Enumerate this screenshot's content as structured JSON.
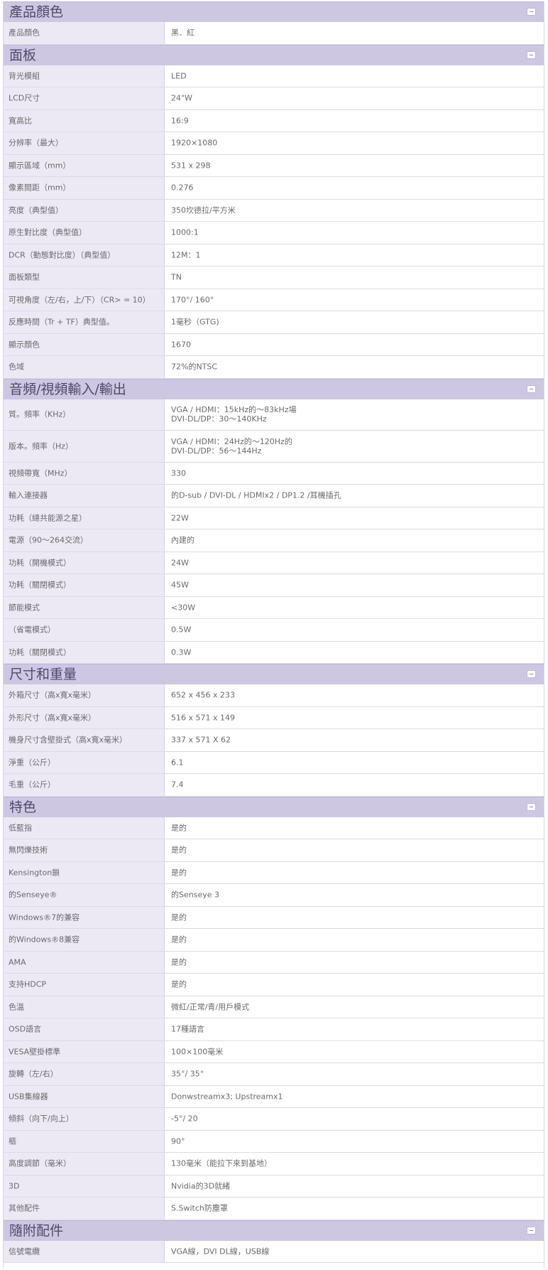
{
  "sections": [
    {
      "title": "產品顏色",
      "rows": [
        {
          "label": "產品顏色",
          "value": "黑．紅"
        }
      ]
    },
    {
      "title": "面板",
      "rows": [
        {
          "label": "背光模組",
          "value": "LED"
        },
        {
          "label": "LCD尺寸",
          "value": "24\"W"
        },
        {
          "label": "寬高比",
          "value": "16:9"
        },
        {
          "label": "分辨率（最大）",
          "value": "1920×1080"
        },
        {
          "label": "顯示區域（mm）",
          "value": "531 x 298"
        },
        {
          "label": "像素間距（mm）",
          "value": "0.276"
        },
        {
          "label": "亮度（典型值）",
          "value": "350坎德拉/平方米"
        },
        {
          "label": "原生對比度（典型值）",
          "value": "1000:1"
        },
        {
          "label": "DCR（動態對比度）（典型值）",
          "value": "12M：1"
        },
        {
          "label": "面板類型",
          "value": "TN"
        },
        {
          "label": "可視角度（左/右，上/下）（CR> = 10）",
          "value": "170°/ 160°"
        },
        {
          "label": "反應時間（Tr + TF）典型值。",
          "value": "1毫秒（GTG)"
        },
        {
          "label": "顯示顏色",
          "value": "1670"
        },
        {
          "label": "色域",
          "value": "72%的NTSC"
        }
      ]
    },
    {
      "title": "音頻/視頻輸入/輸出",
      "rows": [
        {
          "label": "質。頻率（KHz）",
          "value": "VGA / HDMI：15kHz的～83kHz場\nDVI-DL/DP：30～140KHz",
          "tall": true
        },
        {
          "label": "版本。頻率（Hz）",
          "value": "VGA / HDMI：24Hz的～120Hz的\nDVI-DL/DP：56～144Hz",
          "tall": true
        },
        {
          "label": "視頻帶寬（MHz）",
          "value": "330"
        },
        {
          "label": "輸入連接器",
          "value": "的D-sub / DVI-DL / HDMIx2 / DP1.2 /耳機插孔"
        },
        {
          "label": "功耗（總共能源之星）",
          "value": "22W"
        },
        {
          "label": "電源（90～264交流）",
          "value": "內建的"
        },
        {
          "label": "功耗（開機模式）",
          "value": "24W"
        },
        {
          "label": "功耗（關閉模式）",
          "value": "45W"
        },
        {
          "label": "節能模式",
          "value": "<30W"
        },
        {
          "label": "（省電模式）",
          "value": "0.5W"
        },
        {
          "label": "功耗（關閉模式）",
          "value": "0.3W"
        }
      ]
    },
    {
      "title": "尺寸和重量",
      "rows": [
        {
          "label": "外箱尺寸（高x寬x毫米）",
          "value": "652 x 456 x 233"
        },
        {
          "label": "外形尺寸（高x寬x毫米）",
          "value": "516 x 571 x 149"
        },
        {
          "label": "機身尺寸含壁掛式（高x寬x毫米）",
          "value": "337 x 571 X 62"
        },
        {
          "label": "淨重（公斤）",
          "value": "6.1"
        },
        {
          "label": "毛重（公斤）",
          "value": "7.4"
        }
      ]
    },
    {
      "title": "特色",
      "rows": [
        {
          "label": "低藍指",
          "value": "是的"
        },
        {
          "label": "無閃爍技術",
          "value": "是的"
        },
        {
          "label": "Kensington鎖",
          "value": "是的"
        },
        {
          "label": "的Senseye®",
          "value": "的Senseye 3"
        },
        {
          "label": "Windows®7的兼容",
          "value": "是的"
        },
        {
          "label": "的Windows®8兼容",
          "value": "是的"
        },
        {
          "label": "AMA",
          "value": "是的"
        },
        {
          "label": "支持HDCP",
          "value": "是的"
        },
        {
          "label": "色溫",
          "value": "微紅/正常/青/用戶模式"
        },
        {
          "label": "OSD語言",
          "value": "17種語言"
        },
        {
          "label": "VESA壁掛標準",
          "value": "100×100毫米"
        },
        {
          "label": "旋轉（左/右）",
          "value": "35°/ 35°"
        },
        {
          "label": "USB集線器",
          "value": "Donwstreamx3; Upstreamx1"
        },
        {
          "label": "傾斜（向下/向上）",
          "value": "-5°/ 20"
        },
        {
          "label": "樞",
          "value": "90°"
        },
        {
          "label": "高度調節（毫米）",
          "value": "130毫米（能拉下來到基地）"
        },
        {
          "label": "3D",
          "value": "Nvidia的3D就緒"
        },
        {
          "label": "其他配件",
          "value": "S.Switch防塵罩"
        }
      ]
    },
    {
      "title": "隨附配件",
      "rows": [
        {
          "label": "信號電纜",
          "value": "VGA線，DVI DL線，USB線"
        }
      ]
    }
  ]
}
